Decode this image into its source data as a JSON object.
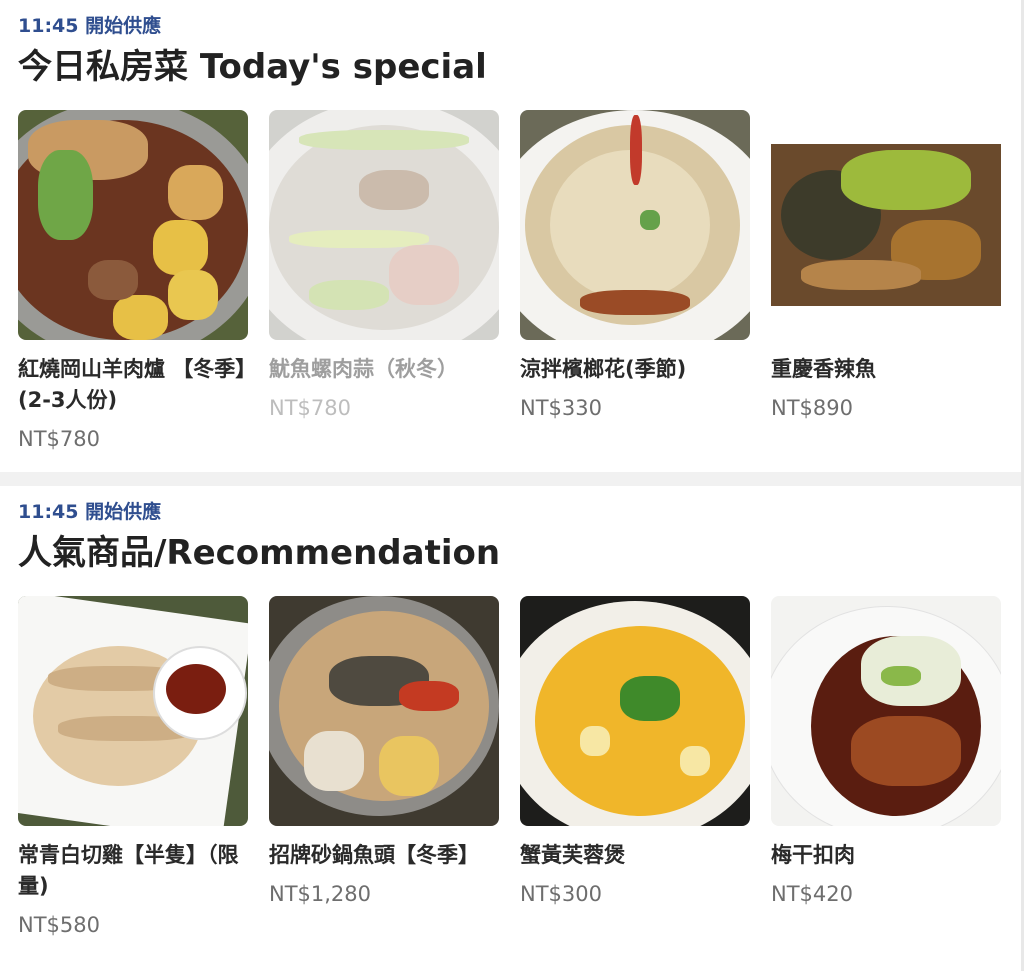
{
  "sections": [
    {
      "time": "11:45 開始供應",
      "title": "今日私房菜 Today's special",
      "items": [
        {
          "name": "紅燒岡山羊肉爐 【冬季】(2-3人份)",
          "price": "NT$780",
          "available": true
        },
        {
          "name": "魷魚螺肉蒜（秋冬）",
          "price": "NT$780",
          "available": false
        },
        {
          "name": "涼拌檳榔花(季節)",
          "price": "NT$330",
          "available": true
        },
        {
          "name": "重慶香辣魚",
          "price": "NT$890",
          "available": true
        }
      ]
    },
    {
      "time": "11:45 開始供應",
      "title": "人氣商品/Recommendation",
      "items": [
        {
          "name": "常青白切雞【半隻】（限量)",
          "price": "NT$580",
          "available": true
        },
        {
          "name": "招牌砂鍋魚頭【冬季】",
          "price": "NT$1,280",
          "available": true
        },
        {
          "name": "蟹黃芙蓉煲",
          "price": "NT$300",
          "available": true
        },
        {
          "name": "梅干扣肉",
          "price": "NT$420",
          "available": true
        }
      ]
    }
  ]
}
